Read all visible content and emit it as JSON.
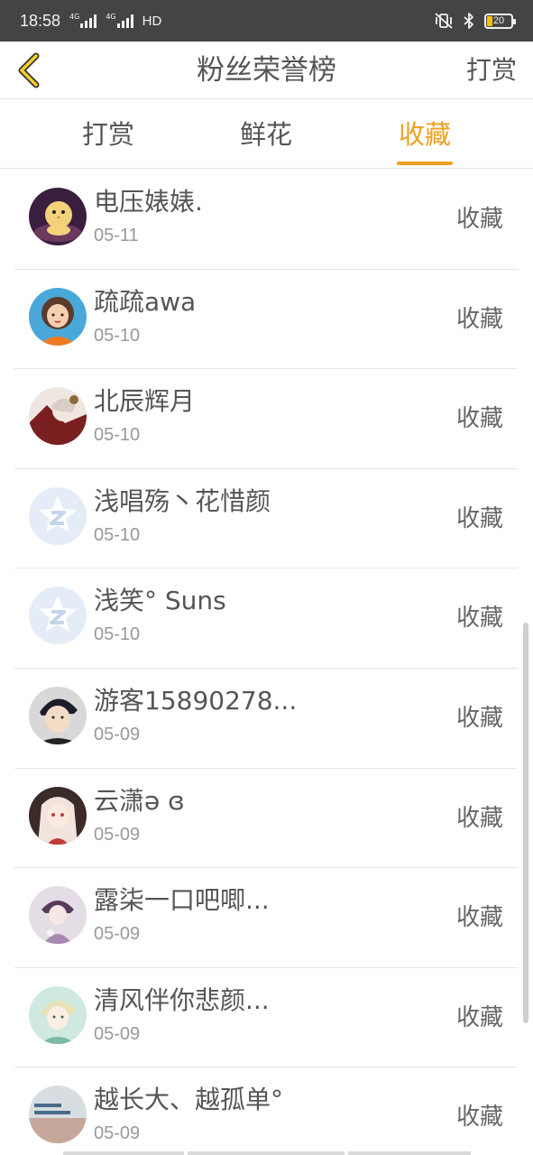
{
  "status_bar": {
    "time": "18:58",
    "network_tag_1": "4G",
    "network_tag_2": "4G",
    "hd": "HD",
    "battery": "20"
  },
  "nav": {
    "title": "粉丝荣誉榜",
    "action": "打赏",
    "back_icon": "chevron-left-icon",
    "accent_color": "#f0a020"
  },
  "tabs": [
    {
      "label": "打赏",
      "active": false
    },
    {
      "label": "鲜花",
      "active": false
    },
    {
      "label": "收藏",
      "active": true
    }
  ],
  "rows": [
    {
      "name": "电压婊婊.",
      "date": "05-11",
      "action": "收藏",
      "avatar": "chick-avatar"
    },
    {
      "name": "疏疏awa",
      "date": "05-10",
      "action": "收藏",
      "avatar": "girl-avatar"
    },
    {
      "name": "北辰辉月",
      "date": "05-10",
      "action": "收藏",
      "avatar": "anime-avatar"
    },
    {
      "name": "浅唱殇丶花惜颜",
      "date": "05-10",
      "action": "收藏",
      "avatar": "default-avatar"
    },
    {
      "name": "浅笑° Suns",
      "date": "05-10",
      "action": "收藏",
      "avatar": "default-avatar"
    },
    {
      "name": "游客15890278...",
      "date": "05-09",
      "action": "收藏",
      "avatar": "boy-avatar"
    },
    {
      "name": "云潇ə ɞ",
      "date": "05-09",
      "action": "收藏",
      "avatar": "anime-girl-avatar"
    },
    {
      "name": "露柒一口吧唧...",
      "date": "05-09",
      "action": "收藏",
      "avatar": "doll-avatar"
    },
    {
      "name": "清风伴你悲颜...",
      "date": "05-09",
      "action": "收藏",
      "avatar": "anime-boy-avatar"
    },
    {
      "name": "越长大、越孤单°",
      "date": "05-09",
      "action": "收藏",
      "avatar": "text-avatar"
    }
  ]
}
